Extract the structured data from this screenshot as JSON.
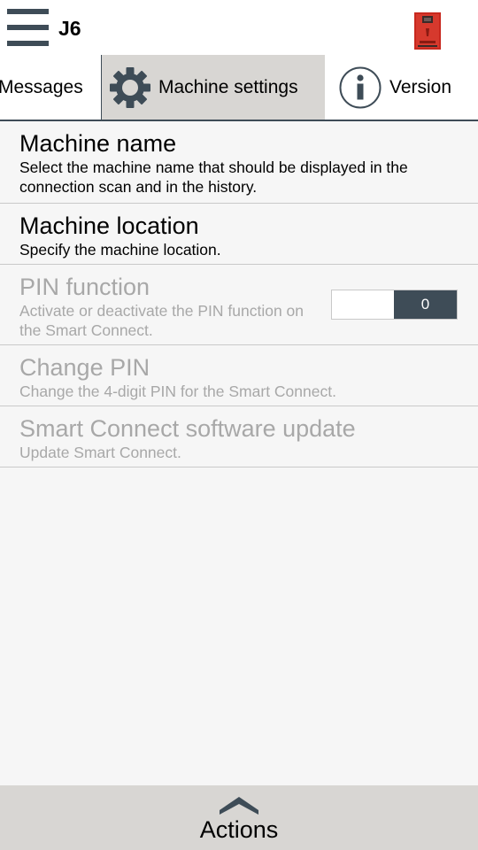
{
  "header": {
    "app_title": "J6",
    "menu_icon": "hamburger-menu-icon",
    "machine_icon": "coffee-machine-icon"
  },
  "tabs": [
    {
      "label": "Messages",
      "active": false
    },
    {
      "label": "Machine settings",
      "icon": "gear-icon",
      "active": true
    },
    {
      "label": "Version",
      "icon": "info-icon",
      "active": false
    }
  ],
  "settings": {
    "machine_name": {
      "title": "Machine name",
      "description": "Select the machine name that should be displayed in the connection scan and in the history."
    },
    "machine_location": {
      "title": "Machine location",
      "description": "Specify the machine location."
    },
    "pin_function": {
      "title": "PIN function",
      "description": "Activate or deactivate the PIN function on the Smart Connect.",
      "toggle_value": "0"
    },
    "change_pin": {
      "title": "Change PIN",
      "description": "Change the 4-digit PIN for the Smart Connect."
    },
    "software_update": {
      "title": "Smart Connect software update",
      "description": "Update Smart Connect."
    }
  },
  "bottom_bar": {
    "label": "Actions",
    "icon": "chevron-up-icon"
  },
  "colors": {
    "accent_dark": "#3e4c57",
    "active_tab_bg": "#d8d6d3",
    "disabled_text": "#a8a8a8",
    "machine_red": "#c8281e"
  }
}
